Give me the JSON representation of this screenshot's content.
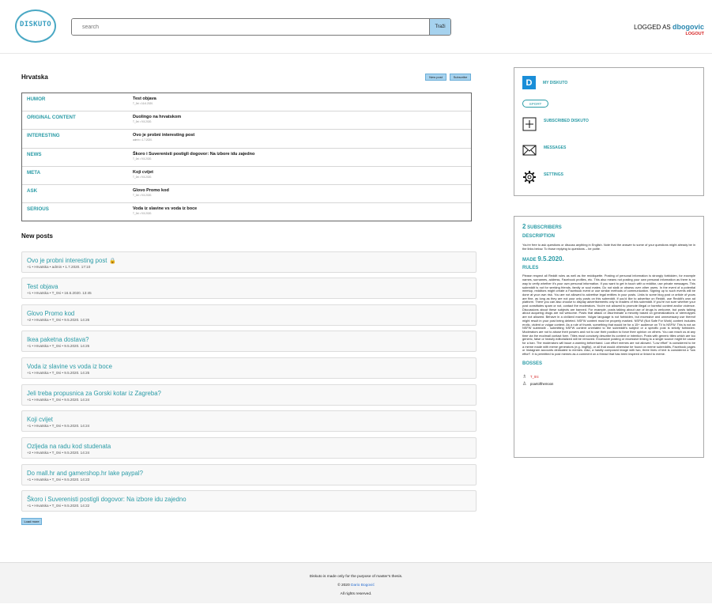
{
  "header": {
    "logo_text": "DISKUTO",
    "search_placeholder": "search",
    "search_button": "Traži",
    "logged_as_prefix": "LOGGED AS",
    "username": "dbogovic",
    "logout": "LOGOUT"
  },
  "community": {
    "title": "Hrvatska",
    "new_post_button": "New post",
    "subscribe_button": "Subscribe"
  },
  "categories": [
    {
      "name": "HUMOR",
      "post_title": "Test objava",
      "post_meta": "T_0ni • 16.6.2020."
    },
    {
      "name": "ORIGINAL CONTENT",
      "post_title": "Duolingo na hrvatskom",
      "post_meta": "T_0ni • 9.5.2020."
    },
    {
      "name": "INTERESTING",
      "post_title": "Ovo je probni interesting post",
      "post_meta": "admin • 1.7.2020."
    },
    {
      "name": "NEWS",
      "post_title": "Škoro i Suverenisti postigli dogovor: Na izbore idu zajedno",
      "post_meta": "T_0ni • 9.5.2020."
    },
    {
      "name": "META",
      "post_title": "Koji cvijet",
      "post_meta": "T_0ni • 9.5.2020."
    },
    {
      "name": "ASK",
      "post_title": "Glovo Promo kod",
      "post_meta": "T_0ni • 9.5.2020."
    },
    {
      "name": "SERIOUS",
      "post_title": "Voda iz slavine vs voda iz boce",
      "post_meta": "T_0ni • 9.5.2020."
    }
  ],
  "new_posts_title": "New posts",
  "posts": [
    {
      "title": "Ovo je probni interesting post",
      "meta": "+1 • Hrvatska • admin • 1.7.2020. 17:10"
    },
    {
      "title": "Test objava",
      "meta": "+1 • Hrvatska • T_0ni • 16.6.2020. 13:45"
    },
    {
      "title": "Glovo Promo kod",
      "meta": "+2 • Hrvatska • T_0ni • 9.5.2020. 14:26"
    },
    {
      "title": "Ikea paketna dostava?",
      "meta": "+1 • Hrvatska • T_0ni • 9.5.2020. 14:25"
    },
    {
      "title": "Voda iz slavine vs voda iz boce",
      "meta": "+1 • Hrvatska • T_0ni • 9.5.2020. 14:25"
    },
    {
      "title": "Jeli treba propusnica za Gorski kotar iz Zagreba?",
      "meta": "+1 • Hrvatska • T_0ni • 9.5.2020. 14:24"
    },
    {
      "title": "Koji cvijet",
      "meta": "+1 • Hrvatska • T_0ni • 9.5.2020. 14:24"
    },
    {
      "title": "Ozljeda na radu kod studenata",
      "meta": "+2 • Hrvatska • T_0ni • 9.5.2020. 14:24"
    },
    {
      "title": "Do mall.hr and gamershop.hr lake paypal?",
      "meta": "+1 • Hrvatska • T_0ni • 9.5.2020. 14:23"
    },
    {
      "title": "Škoro i Suverenisti postigli dogovor: Na izbore idu zajedno",
      "meta": "+1 • Hrvatska • T_0ni • 9.5.2020. 14:22"
    }
  ],
  "load_more": "Load more",
  "sidebar": {
    "my_diskuto_letter": "D",
    "my_diskuto": "MY DISKUTO",
    "sport_pill": "SPORT",
    "subscribed": "SUBSCRIBED DISKUTO",
    "messages": "MESSAGES",
    "settings": "SETTINGS"
  },
  "about": {
    "subscribers_count": "2",
    "subscribers_label": "SUBSCRIBERS",
    "description_heading": "DESCRIPTION",
    "description": "You're free to ask questions or discuss anything in English. Note that the answer to some of your questions might already be in the links below. To those replying to questions – be polite.",
    "made_label": "MADE",
    "made_date": "9.5.2020.",
    "rules_heading": "RULES",
    "rules": "Please respect all Reddit rules as well as the reddiquette. Posting of personal information is strongly forbidden, for example names, surnames, address, Facebook profiles, etc. This also means not posting your own personal information as there is no way to verify whether it's your own personal information. If you want to get in touch with a redditor, use private messages. This subreddit is not for seeking friends, family or soul mates. Do not stalk or obsess over other users. In the event of a potential meetup, redditors might create a Facebook event or use similar methods of communication. Signing up to such events will be done at your own risk. You are not allowed to advertise legal entities in your posts. Links to some blog post or article of yours are fine, as long as they are not your only posts on this subreddit. If you'd like to advertise on Reddit, use Reddit's own ad platform. There you can also choose to display advertisements only to readers of this subreddit. If you're not sure whether your post constitutes spam or not, contact the moderators. You're not allowed to promote illegal or harmful content and/or violence. Discussions about these subjects are banned. For example, posts talking about use of drugs is welcome, but posts talking about acquiring drugs are not welcome. Posts that attack or discriminate a minority based on generalizations or stereotypes are not allowed. Behave in a civilized manner. Vulgar language is not forbidden, but excessive and unnecessary use thereof might result in your post being deleted. NSFW content must be properly marked. NSFW (Not Safe For Work) content includes erotic, violent or vulgar content. As a rule of thumb, something that would be for a 15+ audience on TV is NSFW. This is not an NSFW subreddit - submitting NSFW content unrelated to the subreddit's subject or a specific post is strictly forbidden. Moderators are not to abuse their powers and not to use their position to force their opinion on others. You can reach us at any time via the modmail contact form. Titles must concisely describe its content or intention. Posts with generic titles which are too generic, false or heavily editorialized will be removed. Excessive posting or excessive linking to a single source might be cause for a ban. The moderators will issue a warning beforehand. Low effort memes are not allowed. \"Low effort\" is considered to be a meme made with meme generators (e.g. imgflip), or all that would otherwise be found on meme subreddits, Facebook pages or Instagram accounts dedicated to memes. Also, a hastily composed image with two, three lines of text is considered a \"low effort\". It is permitted to post memes as a comment on a thread that has been inspired or linked to meme.",
    "bosses_heading": "BOSSES",
    "bosses": [
      {
        "name": "T_0ni",
        "color": "#d52020"
      },
      {
        "name": "poartofthemoon",
        "color": "#222222"
      }
    ]
  },
  "footer": {
    "line1": "Diskuto is made only for the purpose of master's thesis.",
    "line2_prefix": "© 2020",
    "author": "Dario Bogović",
    "line3": "All rights reserved."
  }
}
